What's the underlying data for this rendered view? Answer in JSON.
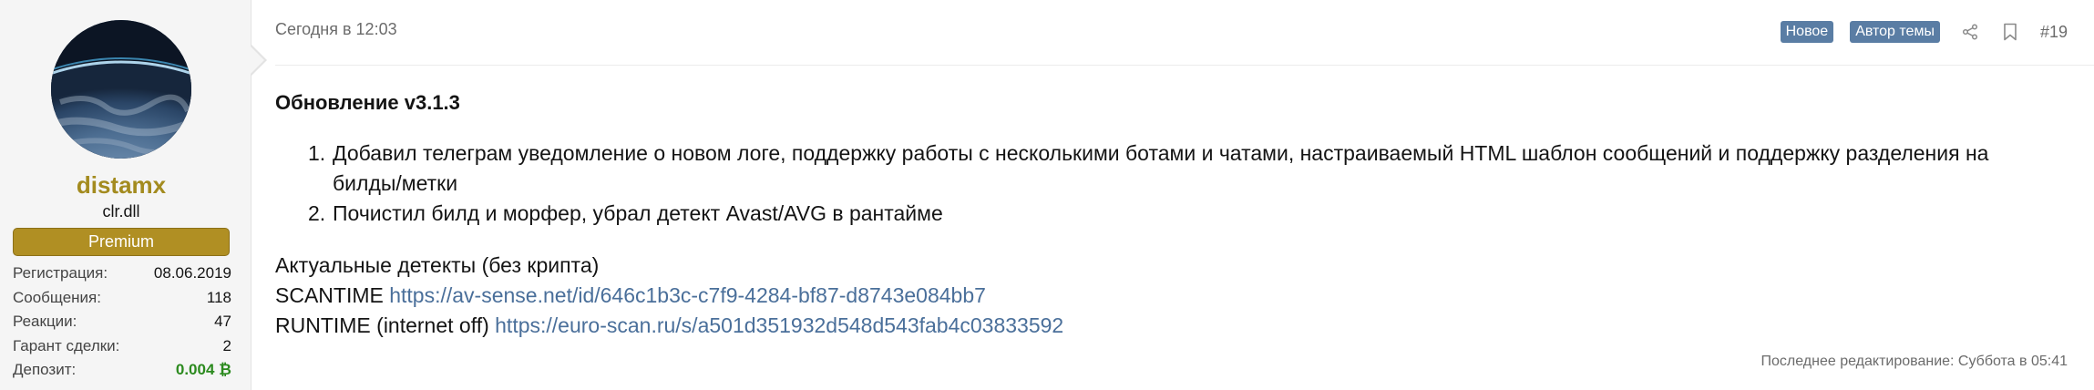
{
  "user": {
    "name": "distamx",
    "title": "clr.dll",
    "banner": "Premium",
    "stats": [
      {
        "label": "Регистрация:",
        "value": "08.06.2019"
      },
      {
        "label": "Сообщения:",
        "value": "118"
      },
      {
        "label": "Реакции:",
        "value": "47"
      },
      {
        "label": "Гарант сделки:",
        "value": "2"
      },
      {
        "label": "Депозит:",
        "value": "0.004 ₿"
      }
    ]
  },
  "post": {
    "date": "Сегодня в 12:03",
    "badges": [
      "Новое",
      "Автор темы"
    ],
    "number": "#19",
    "title": "Обновление v3.1.3",
    "changes": [
      {
        "num": "1.",
        "text": "Добавил телеграм уведомление о новом логе, поддержку работы с несколькими ботами и чатами, настраиваемый HTML шаблон сообщений и поддержку разделения на билды/метки"
      },
      {
        "num": "2.",
        "text": "Почистил билд и морфер, убрал детект Avast/AVG в рантайме"
      }
    ],
    "detects_heading": "Актуальные детекты (без крипта)",
    "scantime_label": "SCANTIME",
    "scantime_link": "https://av-sense.net/id/646c1b3c-c7f9-4284-bf87-d8743e084bb7",
    "runtime_label": "RUNTIME (internet off)",
    "runtime_link": "https://euro-scan.ru/s/a501d351932d548d543fab4c03833592",
    "edited": "Последнее редактирование: Суббота в 05:41"
  },
  "colors": {
    "username": "#a38b1f",
    "banner": "#b08f23",
    "badge": "#5a7da4",
    "link": "#4a6f9a",
    "deposit": "#2b8a1e"
  },
  "icons": {
    "share": "share-icon",
    "bookmark": "bookmark-icon"
  }
}
